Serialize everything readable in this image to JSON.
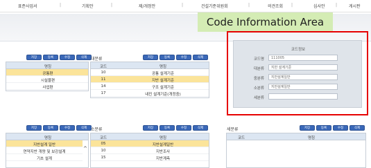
{
  "nav": {
    "items": [
      "표준사업서",
      "기획안",
      "제/개정안",
      "건설기준위원회",
      "의견조회",
      "심사안",
      "게시판"
    ]
  },
  "callout": {
    "text": "Code Information Area"
  },
  "info_panel": {
    "title": "코드정보",
    "rows": [
      {
        "label": "코드명",
        "value": "111005"
      },
      {
        "label": "대분류",
        "value": "지반 설계기준"
      },
      {
        "label": "중분류",
        "value": "지반설계일반"
      },
      {
        "label": "소분류",
        "value": "지반설계일반"
      },
      {
        "label": "세분류",
        "value": ""
      }
    ]
  },
  "buttons": {
    "add": "저장",
    "edit": "등록",
    "copy": "수정",
    "delete": "삭제"
  },
  "top_left_grid": {
    "header": "명칭",
    "rows": [
      "공통편",
      "시설물편",
      "사업편"
    ],
    "selected": 0
  },
  "top_middle": {
    "section_label": "대분류",
    "header_code": "코드",
    "header_name": "명칭",
    "rows": [
      {
        "code": "10",
        "name": "공통 설계기준"
      },
      {
        "code": "11",
        "name": "지반 설계기준"
      },
      {
        "code": "14",
        "name": "구조 설계기준"
      },
      {
        "code": "17",
        "name": "내진 설계기준(개정중)"
      }
    ],
    "selected": 1
  },
  "bottom_left_grid": {
    "header": "명칭",
    "rows": [
      "지반설계 일반",
      "연약지반 개량 및 보강설계",
      "기초 설계"
    ],
    "selected": 0
  },
  "bottom_middle": {
    "section_label": "소분류",
    "header_code": "코드",
    "header_name": "명칭",
    "rows": [
      {
        "code": "05",
        "name": "지반설계일반"
      },
      {
        "code": "10",
        "name": "지반조사"
      },
      {
        "code": "15",
        "name": "지반계측"
      }
    ],
    "selected": 0
  },
  "bottom_right": {
    "section_label": "세분류",
    "header_code": "코드",
    "header_name": "명칭"
  },
  "colors": {
    "button_blue": "#3a68b8",
    "selected_row": "#fbe49a",
    "grid_header": "#dce6f2",
    "callout_green": "#d4ecb4",
    "frame_red": "#e60000"
  }
}
